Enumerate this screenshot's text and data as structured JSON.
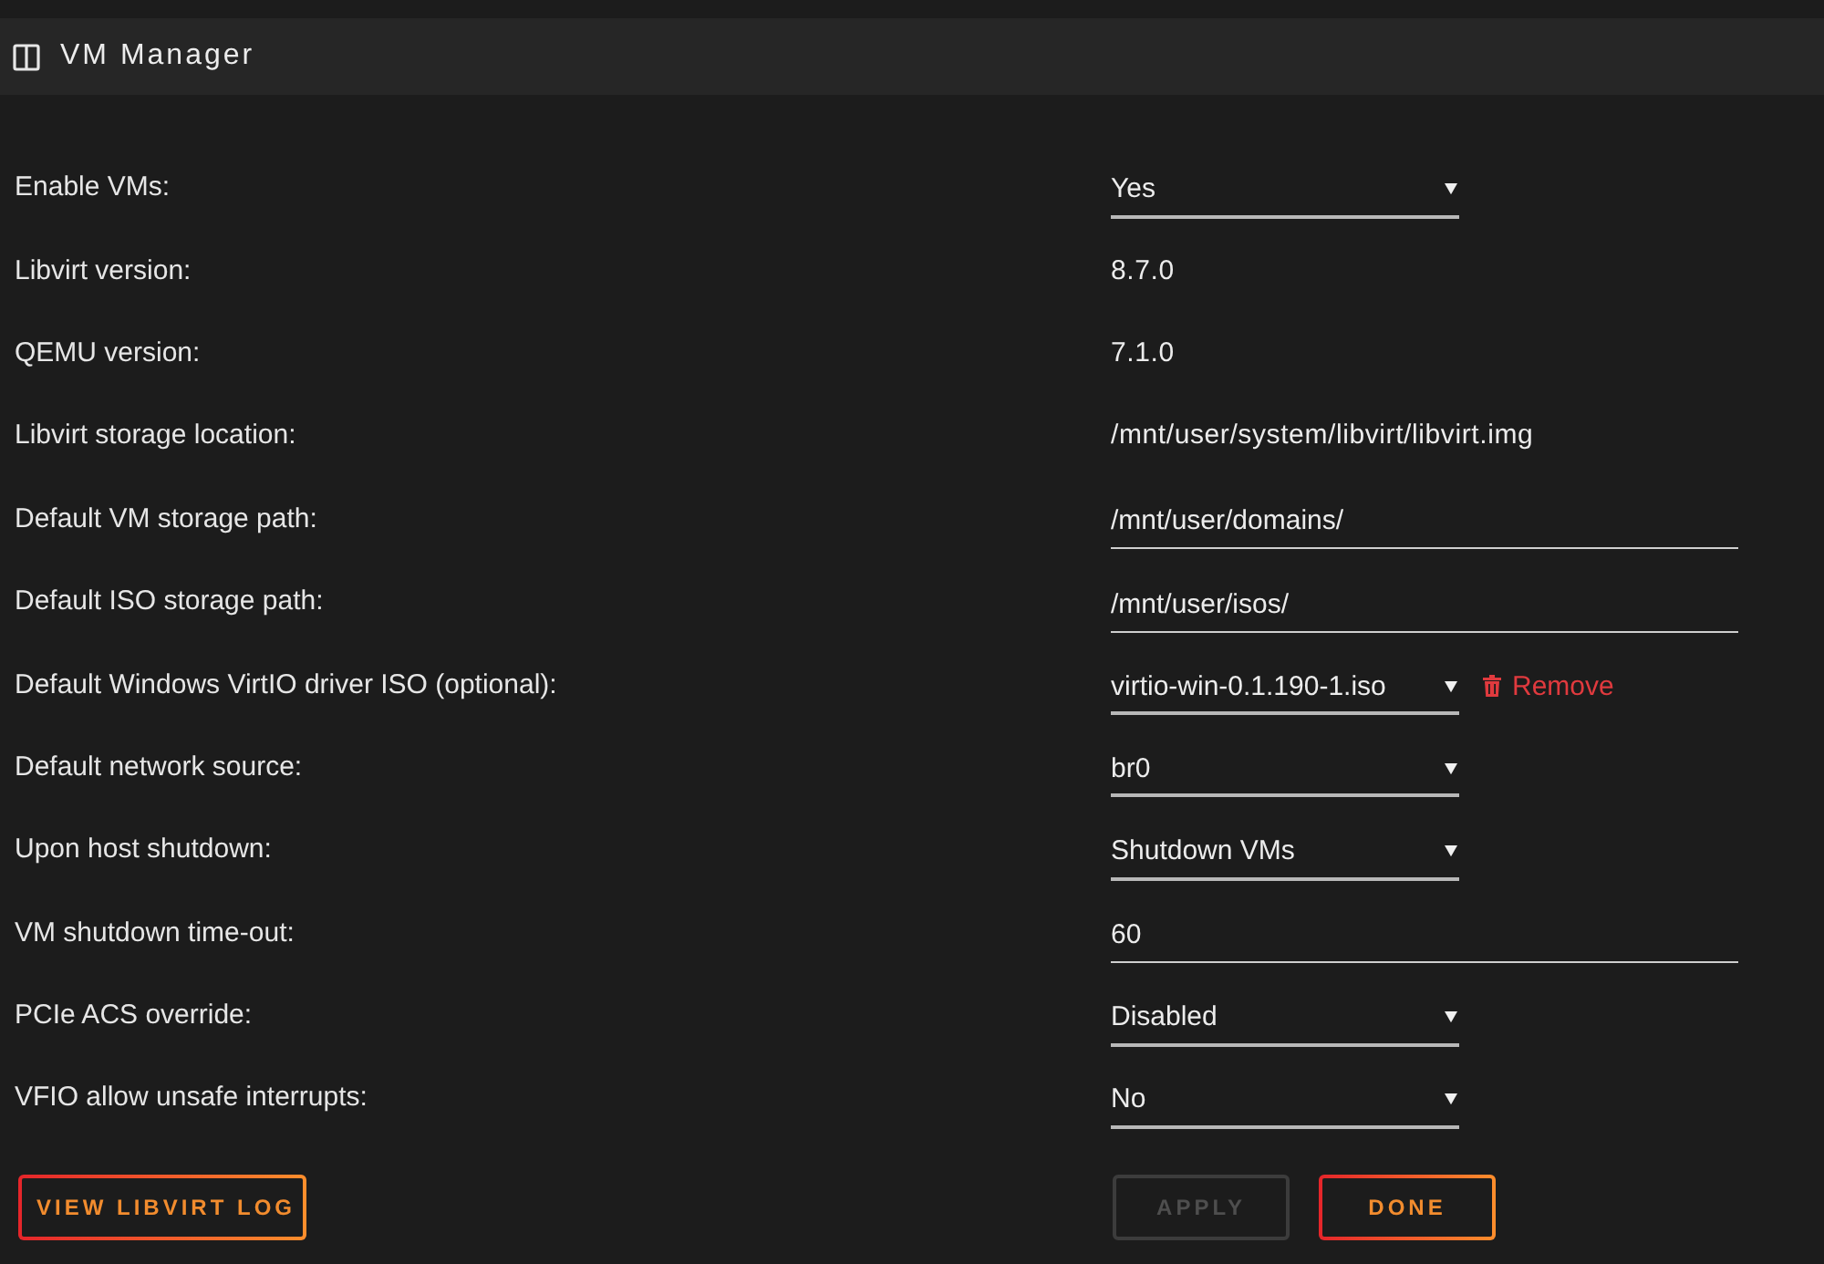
{
  "header": {
    "title": "VM Manager"
  },
  "settings": [
    {
      "label": "Enable VMs:",
      "kind": "select",
      "value": "Yes"
    },
    {
      "label": "Libvirt version:",
      "kind": "text",
      "value": "8.7.0"
    },
    {
      "label": "QEMU version:",
      "kind": "text",
      "value": "7.1.0"
    },
    {
      "label": "Libvirt storage location:",
      "kind": "text",
      "value": "/mnt/user/system/libvirt/libvirt.img"
    },
    {
      "label": "Default VM storage path:",
      "kind": "input",
      "value": "/mnt/user/domains/"
    },
    {
      "label": "Default ISO storage path:",
      "kind": "input",
      "value": "/mnt/user/isos/"
    },
    {
      "label": "Default Windows VirtIO driver ISO (optional):",
      "kind": "select",
      "value": "virtio-win-0.1.190-1.iso",
      "action": "Remove"
    },
    {
      "label": "Default network source:",
      "kind": "select",
      "value": "br0"
    },
    {
      "label": "Upon host shutdown:",
      "kind": "select",
      "value": "Shutdown VMs"
    },
    {
      "label": "VM shutdown time-out:",
      "kind": "input",
      "value": "60"
    },
    {
      "label": "PCIe ACS override:",
      "kind": "select",
      "value": "Disabled"
    },
    {
      "label": "VFIO allow unsafe interrupts:",
      "kind": "select",
      "value": "No"
    }
  ],
  "log_button": {
    "label": "VIEW LIBVIRT LOG"
  },
  "buttons": [
    {
      "label": "APPLY",
      "disabled": true
    },
    {
      "label": "DONE",
      "disabled": false
    }
  ]
}
